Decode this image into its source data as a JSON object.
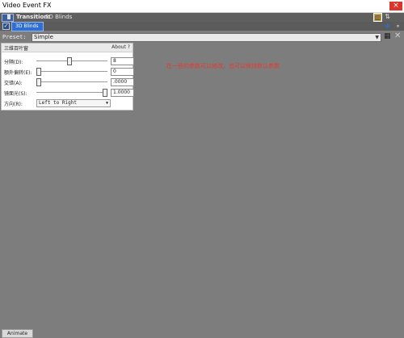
{
  "window": {
    "title": "Video Event FX",
    "close_label": "×"
  },
  "transition": {
    "label": "Transition:",
    "value": "3D Blinds"
  },
  "chain": {
    "check_mark": "✓",
    "button_label": "3D Blinds"
  },
  "preset": {
    "label": "Preset:",
    "value": "Simple"
  },
  "panel": {
    "title": "三维百叶窗",
    "about_label": "About ?",
    "params": [
      {
        "label": "分隔(D):",
        "value": "8",
        "slider_fraction": 0.46
      },
      {
        "label": "额外偏转(E):",
        "value": "0",
        "slider_fraction": 0.0
      },
      {
        "label": "交错(A):",
        "value": ".0000",
        "slider_fraction": 0.0
      },
      {
        "label": "镜面光(S):",
        "value": "1.0000",
        "slider_fraction": 1.0
      }
    ],
    "direction": {
      "label": "方向(R):",
      "value": "Left to Right"
    }
  },
  "annotation": "在一些的参数可以修改，也可以保持默认参数",
  "footer": {
    "animate_label": "Animate"
  },
  "colors": {
    "annotation": "#e8382f",
    "accent": "#2f6fd1",
    "close": "#d9372b",
    "background": "#7d7d7d"
  }
}
